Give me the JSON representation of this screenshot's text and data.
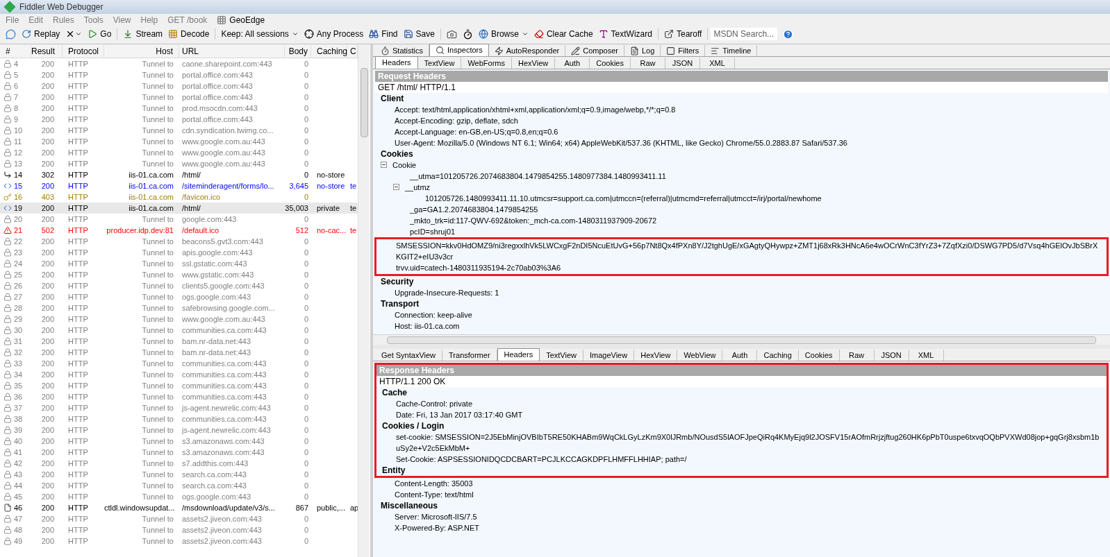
{
  "window": {
    "title": "Fiddler Web Debugger"
  },
  "menu": [
    {
      "label": "File"
    },
    {
      "label": "Edit"
    },
    {
      "label": "Rules"
    },
    {
      "label": "Tools"
    },
    {
      "label": "View"
    },
    {
      "label": "Help"
    },
    {
      "label": "GET /book"
    },
    {
      "label": "GeoEdge"
    }
  ],
  "toolbar": {
    "items": [
      {
        "label": "Replay",
        "dropdown": false
      },
      {
        "label": "Go",
        "dropdown": false
      },
      {
        "label": "Stream",
        "dropdown": false
      },
      {
        "label": "Decode",
        "dropdown": false
      },
      {
        "label": "Keep: All sessions",
        "dropdown": true
      },
      {
        "label": "Any Process",
        "dropdown": false
      },
      {
        "label": "Find",
        "dropdown": false
      },
      {
        "label": "Save",
        "dropdown": false
      },
      {
        "label": "Browse",
        "dropdown": true
      },
      {
        "label": "Clear Cache",
        "dropdown": false
      },
      {
        "label": "TextWizard",
        "dropdown": false
      },
      {
        "label": "Tearoff",
        "dropdown": false
      }
    ],
    "search": {
      "placeholder": "MSDN Search..."
    }
  },
  "sessions": {
    "columns": [
      "#",
      "Result",
      "Protocol",
      "Host",
      "URL",
      "Body",
      "Caching",
      "C"
    ],
    "rows": [
      {
        "num": "4",
        "result": "200",
        "protocol": "HTTP",
        "host": "Tunnel to",
        "url": "caone.sharepoint.com:443",
        "body": "0",
        "kind": "tunnel",
        "color": "#808080",
        "selected": false
      },
      {
        "num": "5",
        "result": "200",
        "protocol": "HTTP",
        "host": "Tunnel to",
        "url": "portal.office.com:443",
        "body": "0",
        "kind": "tunnel",
        "color": "#808080",
        "selected": false
      },
      {
        "num": "6",
        "result": "200",
        "protocol": "HTTP",
        "host": "Tunnel to",
        "url": "portal.office.com:443",
        "body": "0",
        "kind": "tunnel",
        "color": "#808080",
        "selected": false
      },
      {
        "num": "7",
        "result": "200",
        "protocol": "HTTP",
        "host": "Tunnel to",
        "url": "portal.office.com:443",
        "body": "0",
        "kind": "tunnel",
        "color": "#808080",
        "selected": false
      },
      {
        "num": "8",
        "result": "200",
        "protocol": "HTTP",
        "host": "Tunnel to",
        "url": "prod.msocdn.com:443",
        "body": "0",
        "kind": "tunnel",
        "color": "#808080",
        "selected": false
      },
      {
        "num": "9",
        "result": "200",
        "protocol": "HTTP",
        "host": "Tunnel to",
        "url": "portal.office.com:443",
        "body": "0",
        "kind": "tunnel",
        "color": "#808080",
        "selected": false
      },
      {
        "num": "10",
        "result": "200",
        "protocol": "HTTP",
        "host": "Tunnel to",
        "url": "cdn.syndication.twimg.co...",
        "body": "0",
        "kind": "tunnel",
        "color": "#808080",
        "selected": false
      },
      {
        "num": "11",
        "result": "200",
        "protocol": "HTTP",
        "host": "Tunnel to",
        "url": "www.google.com.au:443",
        "body": "0",
        "kind": "tunnel",
        "color": "#808080",
        "selected": false
      },
      {
        "num": "12",
        "result": "200",
        "protocol": "HTTP",
        "host": "Tunnel to",
        "url": "www.google.com.au:443",
        "body": "0",
        "kind": "tunnel",
        "color": "#808080",
        "selected": false
      },
      {
        "num": "13",
        "result": "200",
        "protocol": "HTTP",
        "host": "Tunnel to",
        "url": "www.google.com.au:443",
        "body": "0",
        "kind": "tunnel",
        "color": "#808080",
        "selected": false
      },
      {
        "num": "14",
        "result": "302",
        "protocol": "HTTP",
        "host": "iis-01.ca.com",
        "url": "/html/",
        "body": "0",
        "caching": "no-store",
        "kind": "redirect",
        "color": "#000000",
        "selected": false
      },
      {
        "num": "15",
        "result": "200",
        "protocol": "HTTP",
        "host": "iis-01.ca.com",
        "url": "/siteminderagent/forms/lo...",
        "body": "3,645",
        "caching": "no-store",
        "column_8": "te",
        "kind": "html",
        "color": "#0000ff",
        "selected": false
      },
      {
        "num": "16",
        "result": "403",
        "protocol": "HTTP",
        "host": "iis-01.ca.com",
        "url": "/favicon.ico",
        "body": "0",
        "kind": "forbidden",
        "color": "#a08000",
        "selected": false
      },
      {
        "num": "19",
        "result": "200",
        "protocol": "HTTP",
        "host": "iis-01.ca.com",
        "url": "/html/",
        "body": "35,003",
        "caching": "private",
        "column_8": "te",
        "kind": "html",
        "color": "#000000",
        "selected": true
      },
      {
        "num": "20",
        "result": "200",
        "protocol": "HTTP",
        "host": "Tunnel to",
        "url": "google.com:443",
        "body": "0",
        "kind": "tunnel",
        "color": "#808080",
        "selected": false
      },
      {
        "num": "21",
        "result": "502",
        "protocol": "HTTP",
        "host": "producer.idp.dev:81",
        "url": "/default.ico",
        "body": "512",
        "caching": "no-cac...",
        "column_8": "te",
        "kind": "error",
        "color": "#ff0000",
        "selected": false
      },
      {
        "num": "22",
        "result": "200",
        "protocol": "HTTP",
        "host": "Tunnel to",
        "url": "beacons5.gvt3.com:443",
        "body": "0",
        "kind": "tunnel",
        "color": "#808080",
        "selected": false
      },
      {
        "num": "23",
        "result": "200",
        "protocol": "HTTP",
        "host": "Tunnel to",
        "url": "apis.google.com:443",
        "body": "0",
        "kind": "tunnel",
        "color": "#808080",
        "selected": false
      },
      {
        "num": "24",
        "result": "200",
        "protocol": "HTTP",
        "host": "Tunnel to",
        "url": "ssl.gstatic.com:443",
        "body": "0",
        "kind": "tunnel",
        "color": "#808080",
        "selected": false
      },
      {
        "num": "25",
        "result": "200",
        "protocol": "HTTP",
        "host": "Tunnel to",
        "url": "www.gstatic.com:443",
        "body": "0",
        "kind": "tunnel",
        "color": "#808080",
        "selected": false
      },
      {
        "num": "26",
        "result": "200",
        "protocol": "HTTP",
        "host": "Tunnel to",
        "url": "clients5.google.com:443",
        "body": "0",
        "kind": "tunnel",
        "color": "#808080",
        "selected": false
      },
      {
        "num": "27",
        "result": "200",
        "protocol": "HTTP",
        "host": "Tunnel to",
        "url": "ogs.google.com:443",
        "body": "0",
        "kind": "tunnel",
        "color": "#808080",
        "selected": false
      },
      {
        "num": "28",
        "result": "200",
        "protocol": "HTTP",
        "host": "Tunnel to",
        "url": "safebrowsing.google.com...",
        "body": "0",
        "kind": "tunnel",
        "color": "#808080",
        "selected": false
      },
      {
        "num": "29",
        "result": "200",
        "protocol": "HTTP",
        "host": "Tunnel to",
        "url": "www.google.com.au:443",
        "body": "0",
        "kind": "tunnel",
        "color": "#808080",
        "selected": false
      },
      {
        "num": "30",
        "result": "200",
        "protocol": "HTTP",
        "host": "Tunnel to",
        "url": "communities.ca.com:443",
        "body": "0",
        "kind": "tunnel",
        "color": "#808080",
        "selected": false
      },
      {
        "num": "31",
        "result": "200",
        "protocol": "HTTP",
        "host": "Tunnel to",
        "url": "bam.nr-data.net:443",
        "body": "0",
        "kind": "tunnel",
        "color": "#808080",
        "selected": false
      },
      {
        "num": "32",
        "result": "200",
        "protocol": "HTTP",
        "host": "Tunnel to",
        "url": "bam.nr-data.net:443",
        "body": "0",
        "kind": "tunnel",
        "color": "#808080",
        "selected": false
      },
      {
        "num": "33",
        "result": "200",
        "protocol": "HTTP",
        "host": "Tunnel to",
        "url": "communities.ca.com:443",
        "body": "0",
        "kind": "tunnel",
        "color": "#808080",
        "selected": false
      },
      {
        "num": "34",
        "result": "200",
        "protocol": "HTTP",
        "host": "Tunnel to",
        "url": "communities.ca.com:443",
        "body": "0",
        "kind": "tunnel",
        "color": "#808080",
        "selected": false
      },
      {
        "num": "35",
        "result": "200",
        "protocol": "HTTP",
        "host": "Tunnel to",
        "url": "communities.ca.com:443",
        "body": "0",
        "kind": "tunnel",
        "color": "#808080",
        "selected": false
      },
      {
        "num": "36",
        "result": "200",
        "protocol": "HTTP",
        "host": "Tunnel to",
        "url": "communities.ca.com:443",
        "body": "0",
        "kind": "tunnel",
        "color": "#808080",
        "selected": false
      },
      {
        "num": "37",
        "result": "200",
        "protocol": "HTTP",
        "host": "Tunnel to",
        "url": "js-agent.newrelic.com:443",
        "body": "0",
        "kind": "tunnel",
        "color": "#808080",
        "selected": false
      },
      {
        "num": "38",
        "result": "200",
        "protocol": "HTTP",
        "host": "Tunnel to",
        "url": "communities.ca.com:443",
        "body": "0",
        "kind": "tunnel",
        "color": "#808080",
        "selected": false
      },
      {
        "num": "39",
        "result": "200",
        "protocol": "HTTP",
        "host": "Tunnel to",
        "url": "js-agent.newrelic.com:443",
        "body": "0",
        "kind": "tunnel",
        "color": "#808080",
        "selected": false
      },
      {
        "num": "40",
        "result": "200",
        "protocol": "HTTP",
        "host": "Tunnel to",
        "url": "s3.amazonaws.com:443",
        "body": "0",
        "kind": "tunnel",
        "color": "#808080",
        "selected": false
      },
      {
        "num": "41",
        "result": "200",
        "protocol": "HTTP",
        "host": "Tunnel to",
        "url": "s3.amazonaws.com:443",
        "body": "0",
        "kind": "tunnel",
        "color": "#808080",
        "selected": false
      },
      {
        "num": "42",
        "result": "200",
        "protocol": "HTTP",
        "host": "Tunnel to",
        "url": "s7.addthis.com:443",
        "body": "0",
        "kind": "tunnel",
        "color": "#808080",
        "selected": false
      },
      {
        "num": "43",
        "result": "200",
        "protocol": "HTTP",
        "host": "Tunnel to",
        "url": "search.ca.com:443",
        "body": "0",
        "kind": "tunnel",
        "color": "#808080",
        "selected": false
      },
      {
        "num": "44",
        "result": "200",
        "protocol": "HTTP",
        "host": "Tunnel to",
        "url": "search.ca.com:443",
        "body": "0",
        "kind": "tunnel",
        "color": "#808080",
        "selected": false
      },
      {
        "num": "45",
        "result": "200",
        "protocol": "HTTP",
        "host": "Tunnel to",
        "url": "ogs.google.com:443",
        "body": "0",
        "kind": "tunnel",
        "color": "#808080",
        "selected": false
      },
      {
        "num": "46",
        "result": "200",
        "protocol": "HTTP",
        "host": "ctldl.windowsupdat...",
        "url": "/msdownload/update/v3/s...",
        "body": "867",
        "caching": "public,...",
        "column_8": "ap",
        "kind": "text",
        "color": "#000000",
        "selected": false
      },
      {
        "num": "47",
        "result": "200",
        "protocol": "HTTP",
        "host": "Tunnel to",
        "url": "assets2.jiveon.com:443",
        "body": "0",
        "kind": "tunnel",
        "color": "#808080",
        "selected": false
      },
      {
        "num": "48",
        "result": "200",
        "protocol": "HTTP",
        "host": "Tunnel to",
        "url": "assets2.jiveon.com:443",
        "body": "0",
        "kind": "tunnel",
        "color": "#808080",
        "selected": false
      },
      {
        "num": "49",
        "result": "200",
        "protocol": "HTTP",
        "host": "Tunnel to",
        "url": "assets2.jiveon.com:443",
        "body": "0",
        "kind": "tunnel",
        "color": "#808080",
        "selected": false
      }
    ]
  },
  "main_tabs": [
    {
      "label": "Statistics",
      "selected": false
    },
    {
      "label": "Inspectors",
      "selected": true
    },
    {
      "label": "AutoResponder",
      "selected": false
    },
    {
      "label": "Composer",
      "selected": false
    },
    {
      "label": "Log",
      "selected": false
    },
    {
      "label": "Filters",
      "selected": false
    },
    {
      "label": "Timeline",
      "selected": false
    }
  ],
  "request": {
    "tabs": [
      {
        "label": "Headers",
        "selected": true
      },
      {
        "label": "TextView",
        "selected": false
      },
      {
        "label": "WebForms",
        "selected": false
      },
      {
        "label": "HexView",
        "selected": false
      },
      {
        "label": "Auth",
        "selected": false
      },
      {
        "label": "Cookies",
        "selected": false
      },
      {
        "label": "Raw",
        "selected": false
      },
      {
        "label": "JSON",
        "selected": false
      },
      {
        "label": "XML",
        "selected": false
      }
    ],
    "title": "Request Headers",
    "status": "GET /html/ HTTP/1.1",
    "sections": [
      {
        "name": "Client",
        "items": [
          {
            "text": "Accept: text/html,application/xhtml+xml,application/xml;q=0.9,image/webp,*/*;q=0.8"
          },
          {
            "text": "Accept-Encoding: gzip, deflate, sdch"
          },
          {
            "text": "Accept-Language: en-GB,en-US;q=0.8,en;q=0.6"
          },
          {
            "text": "User-Agent: Mozilla/5.0 (Windows NT 6.1; Win64; x64) AppleWebKit/537.36 (KHTML, like Gecko) Chrome/55.0.2883.87 Safari/537.36"
          }
        ]
      },
      {
        "name": "Cookies",
        "items": [
          {
            "text": "Cookie",
            "expanded": true,
            "children": [
              {
                "text": "__utma=101205726.2074683804.1479854255.1480977384.1480993411.11"
              },
              {
                "text": "__utmz",
                "expanded": true,
                "children": [
                  {
                    "text": "101205726.1480993411.11.10.utmcsr=support.ca.com|utmccn=(referral)|utmcmd=referral|utmcct=/irj/portal/newhome"
                  }
                ]
              },
              {
                "text": "_ga=GA1.2.2074683804.1479854255"
              },
              {
                "text": "_mkto_trk=id:117-QWV-692&token:_mch-ca.com-1480311937909-20672"
              },
              {
                "text": "pcID=shruj01"
              }
            ]
          }
        ],
        "framed": [
          {
            "text": "SMSESSION=kkv0HdOMZ9/ni3regxxlhVk5LWCxgF2nDI5NcuEtUvG+56p7Nt8Qx4fPXn8Y/J2tghUgE/xGAgtyQHywpz+ZMT1j68xRk3HNcA6e4wOCrWnC3fYrZ3+7ZqfXzi0/DSWG7PD5/d7Vsq4hGElOvJbSBrXKGIT2+eIU3v3cr"
          },
          {
            "text": "trvv.uid=catech-1480311935194-2c70ab03%3A6"
          }
        ]
      },
      {
        "name": "Security",
        "items": [
          {
            "text": "Upgrade-Insecure-Requests: 1"
          }
        ]
      },
      {
        "name": "Transport",
        "items": [
          {
            "text": "Connection: keep-alive"
          },
          {
            "text": "Host: iis-01.ca.com"
          }
        ]
      }
    ]
  },
  "response": {
    "tabs": [
      {
        "label": "Get SyntaxView",
        "selected": false
      },
      {
        "label": "Transformer",
        "selected": false
      },
      {
        "label": "Headers",
        "selected": true
      },
      {
        "label": "TextView",
        "selected": false
      },
      {
        "label": "ImageView",
        "selected": false
      },
      {
        "label": "HexView",
        "selected": false
      },
      {
        "label": "WebView",
        "selected": false
      },
      {
        "label": "Auth",
        "selected": false
      },
      {
        "label": "Caching",
        "selected": false
      },
      {
        "label": "Cookies",
        "selected": false
      },
      {
        "label": "Raw",
        "selected": false
      },
      {
        "label": "JSON",
        "selected": false
      },
      {
        "label": "XML",
        "selected": false
      }
    ],
    "framed": {
      "title": "Response Headers",
      "status": "HTTP/1.1 200 OK",
      "sections": [
        {
          "name": "Cache",
          "items": [
            {
              "text": "Cache-Control: private"
            },
            {
              "text": "Date: Fri, 13 Jan 2017 03:17:40 GMT"
            }
          ]
        },
        {
          "name": "Cookies / Login",
          "items": [
            {
              "text": "set-cookie: SMSESSION=2J5EbMinjOVBIbT5RE50KHABm9WqCkLGyLzKm9X0lJRmb/NOusdS5lAOFJpeQiRq4KMyEjq9l2JOSFV15rAOfmRrjzjftug260HK6pPbT0uspe6txvqOQbPVXWd08jop+gqGrj8xsbm1buSy2e+V2c5EkMbM+"
            },
            {
              "text": "Set-Cookie: ASPSESSIONIDQCDCBART=PCJLKCCAGKDPFLHMFFLHHIAP; path=/"
            }
          ]
        },
        {
          "name": "Entity"
        }
      ]
    },
    "sections": [
      {
        "items": [
          {
            "text": "Content-Length: 35003"
          },
          {
            "text": "Content-Type: text/html"
          }
        ]
      },
      {
        "name": "Miscellaneous",
        "items": [
          {
            "text": "Server: Microsoft-IIS/7.5"
          },
          {
            "text": "X-Powered-By: ASP.NET"
          }
        ]
      }
    ]
  }
}
